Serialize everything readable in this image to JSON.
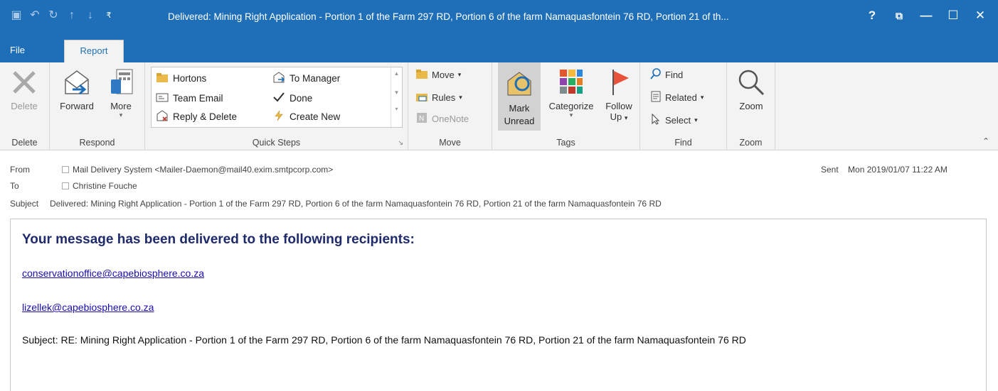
{
  "window": {
    "title": "Delivered: Mining Right Application - Portion 1 of the Farm 297 RD, Portion 6 of the farm Namaquasfontein 76 RD, Portion 21 of th...",
    "help": "?",
    "restore": "⧉",
    "minimize": "—",
    "maximize": "☐",
    "close": "✕"
  },
  "tabs": [
    "File",
    "Report"
  ],
  "ribbon": {
    "delete_group": {
      "label": "Delete",
      "delete": "Delete"
    },
    "respond_group": {
      "label": "Respond",
      "forward": "Forward",
      "more": "More",
      "more_caret": "▾"
    },
    "quicksteps_group": {
      "label": "Quick Steps",
      "items": [
        "Hortons",
        "To Manager",
        "Team Email",
        "Done",
        "Reply & Delete",
        "Create New"
      ],
      "launcher": "↘"
    },
    "move_group": {
      "label": "Move",
      "move": "Move",
      "rules": "Rules",
      "onenote": "OneNote",
      "caret": "▾"
    },
    "tags_group": {
      "label": "Tags",
      "mark": "Mark",
      "unread": "Unread",
      "categorize": "Categorize",
      "follow": "Follow",
      "up": "Up",
      "caret": "▾"
    },
    "find_group": {
      "label": "Find",
      "find": "Find",
      "related": "Related",
      "select": "Select",
      "caret": "▾"
    },
    "zoom_group": {
      "label": "Zoom",
      "zoom": "Zoom"
    }
  },
  "header": {
    "from_label": "From",
    "from_value": "Mail Delivery System <Mailer-Daemon@mail40.exim.smtpcorp.com>",
    "to_label": "To",
    "to_value": "Christine Fouche",
    "subject_label": "Subject",
    "subject_value": "Delivered: Mining Right Application - Portion 1 of the Farm 297 RD, Portion 6 of the farm Namaquasfontein 76 RD, Portion 21 of the farm Namaquasfontein 76 RD",
    "sent_label": "Sent",
    "sent_value": "Mon 2019/01/07 11:22 AM"
  },
  "body": {
    "heading": "Your message has been delivered to the following recipients:",
    "recipients": [
      "conservationoffice@capebiosphere.co.za",
      "lizellek@capebiosphere.co.za"
    ],
    "subject_line": "Subject: RE: Mining Right Application - Portion 1 of the Farm 297 RD, Portion 6 of the farm Namaquasfontein 76 RD, Portion 21 of the farm Namaquasfontein 76 RD"
  },
  "colors": {
    "brand": "#1e6fb8",
    "heading": "#1f2a6b",
    "link": "#1a0dab",
    "flag": "#e8523a"
  }
}
